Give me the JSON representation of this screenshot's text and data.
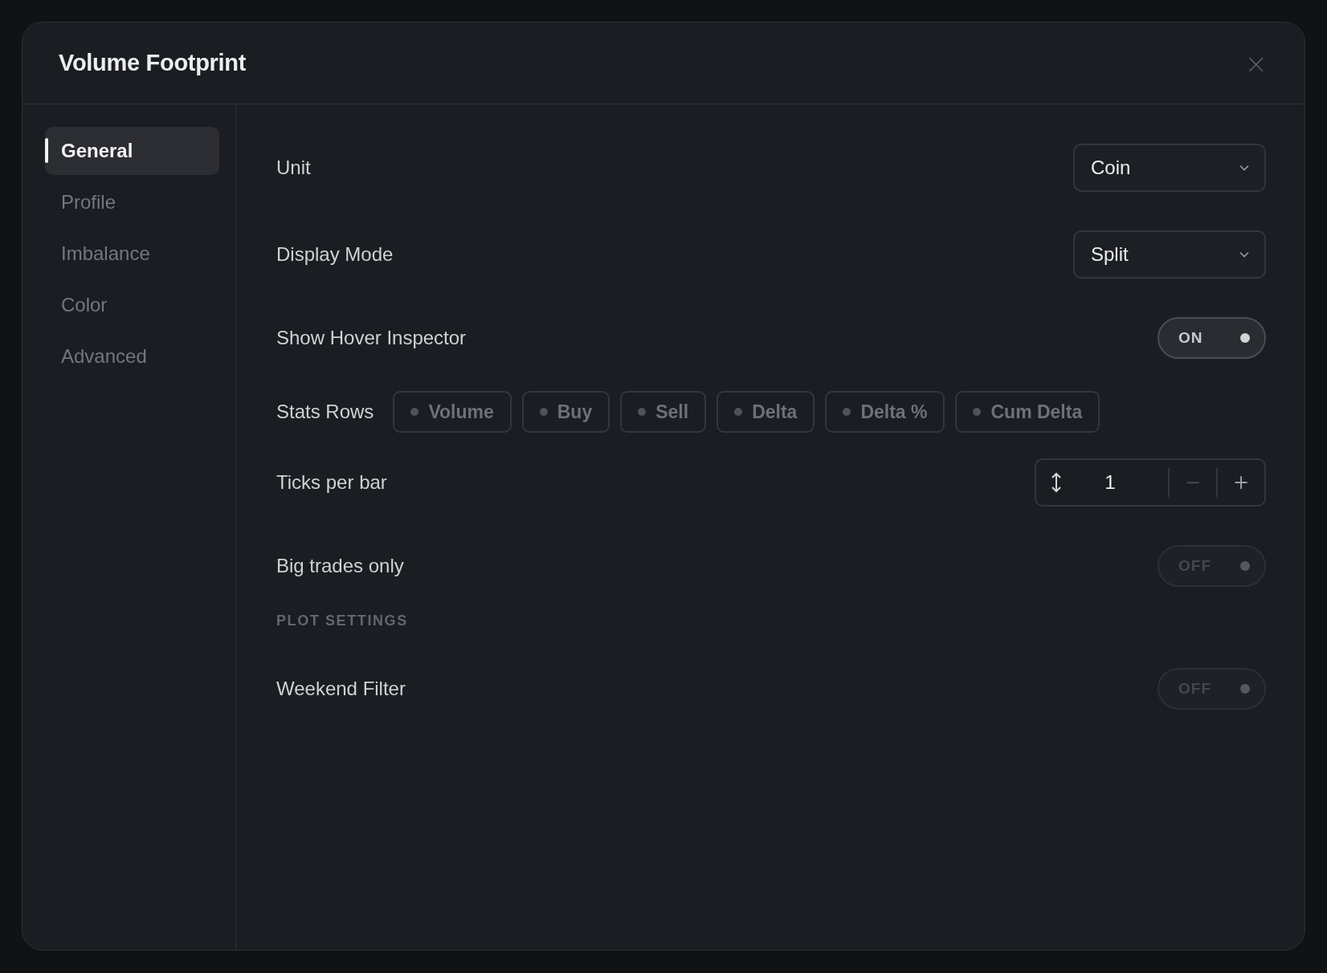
{
  "dialog": {
    "title": "Volume Footprint",
    "close": "×"
  },
  "sidebar": {
    "items": [
      {
        "label": "General",
        "selected": true
      },
      {
        "label": "Profile",
        "selected": false
      },
      {
        "label": "Imbalance",
        "selected": false
      },
      {
        "label": "Color",
        "selected": false
      },
      {
        "label": "Advanced",
        "selected": false
      }
    ]
  },
  "settings": [
    {
      "kind": "select",
      "label": "Unit",
      "value": "Coin"
    },
    {
      "kind": "select",
      "label": "Display Mode",
      "value": "Split"
    },
    {
      "kind": "toggle",
      "label": "Show Hover Inspector",
      "state": "ON",
      "on": true
    },
    {
      "kind": "chips",
      "label": "Stats Rows",
      "chips": [
        {
          "label": "Volume",
          "selected": false
        },
        {
          "label": "Buy",
          "selected": false
        },
        {
          "label": "Sell",
          "selected": false
        },
        {
          "label": "Delta",
          "selected": false
        },
        {
          "label": "Delta %",
          "selected": false
        },
        {
          "label": "Cum Delta",
          "selected": false
        }
      ]
    },
    {
      "kind": "stepper",
      "label": "Ticks per bar",
      "value": "1",
      "decrement": {
        "label": "−",
        "disabled": true
      },
      "increment": {
        "label": "+",
        "disabled": false
      }
    },
    {
      "kind": "toggle",
      "label": "Big trades only",
      "state": "OFF",
      "on": false
    },
    {
      "kind": "heading",
      "label": "PLOT SETTINGS"
    },
    {
      "kind": "toggle",
      "label": "Weekend Filter",
      "state": "OFF",
      "on": false
    }
  ]
}
